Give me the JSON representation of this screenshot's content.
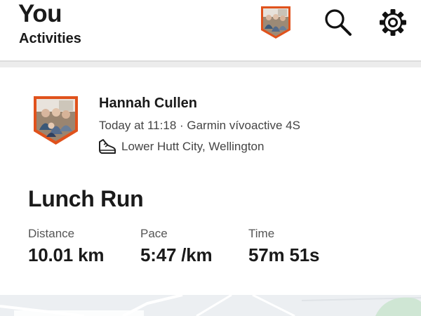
{
  "header": {
    "title": "You",
    "subtitle": "Activities"
  },
  "activity": {
    "athlete_name": "Hannah Cullen",
    "meta": "Today at 11:18 · Garmin vívoactive 4S",
    "location": "Lower Hutt City, Wellington",
    "title": "Lunch Run",
    "stats": {
      "distance_label": "Distance",
      "distance_value": "10.01 km",
      "pace_label": "Pace",
      "pace_value": "5:47 /km",
      "time_label": "Time",
      "time_value": "57m 51s"
    }
  },
  "colors": {
    "badge_border": "#e0521c",
    "text": "#1a1a1a",
    "secondary_text": "#444444",
    "divider": "#ececec"
  },
  "icons": [
    "avatar-badge",
    "search-icon",
    "gear-icon",
    "shoe-icon"
  ]
}
